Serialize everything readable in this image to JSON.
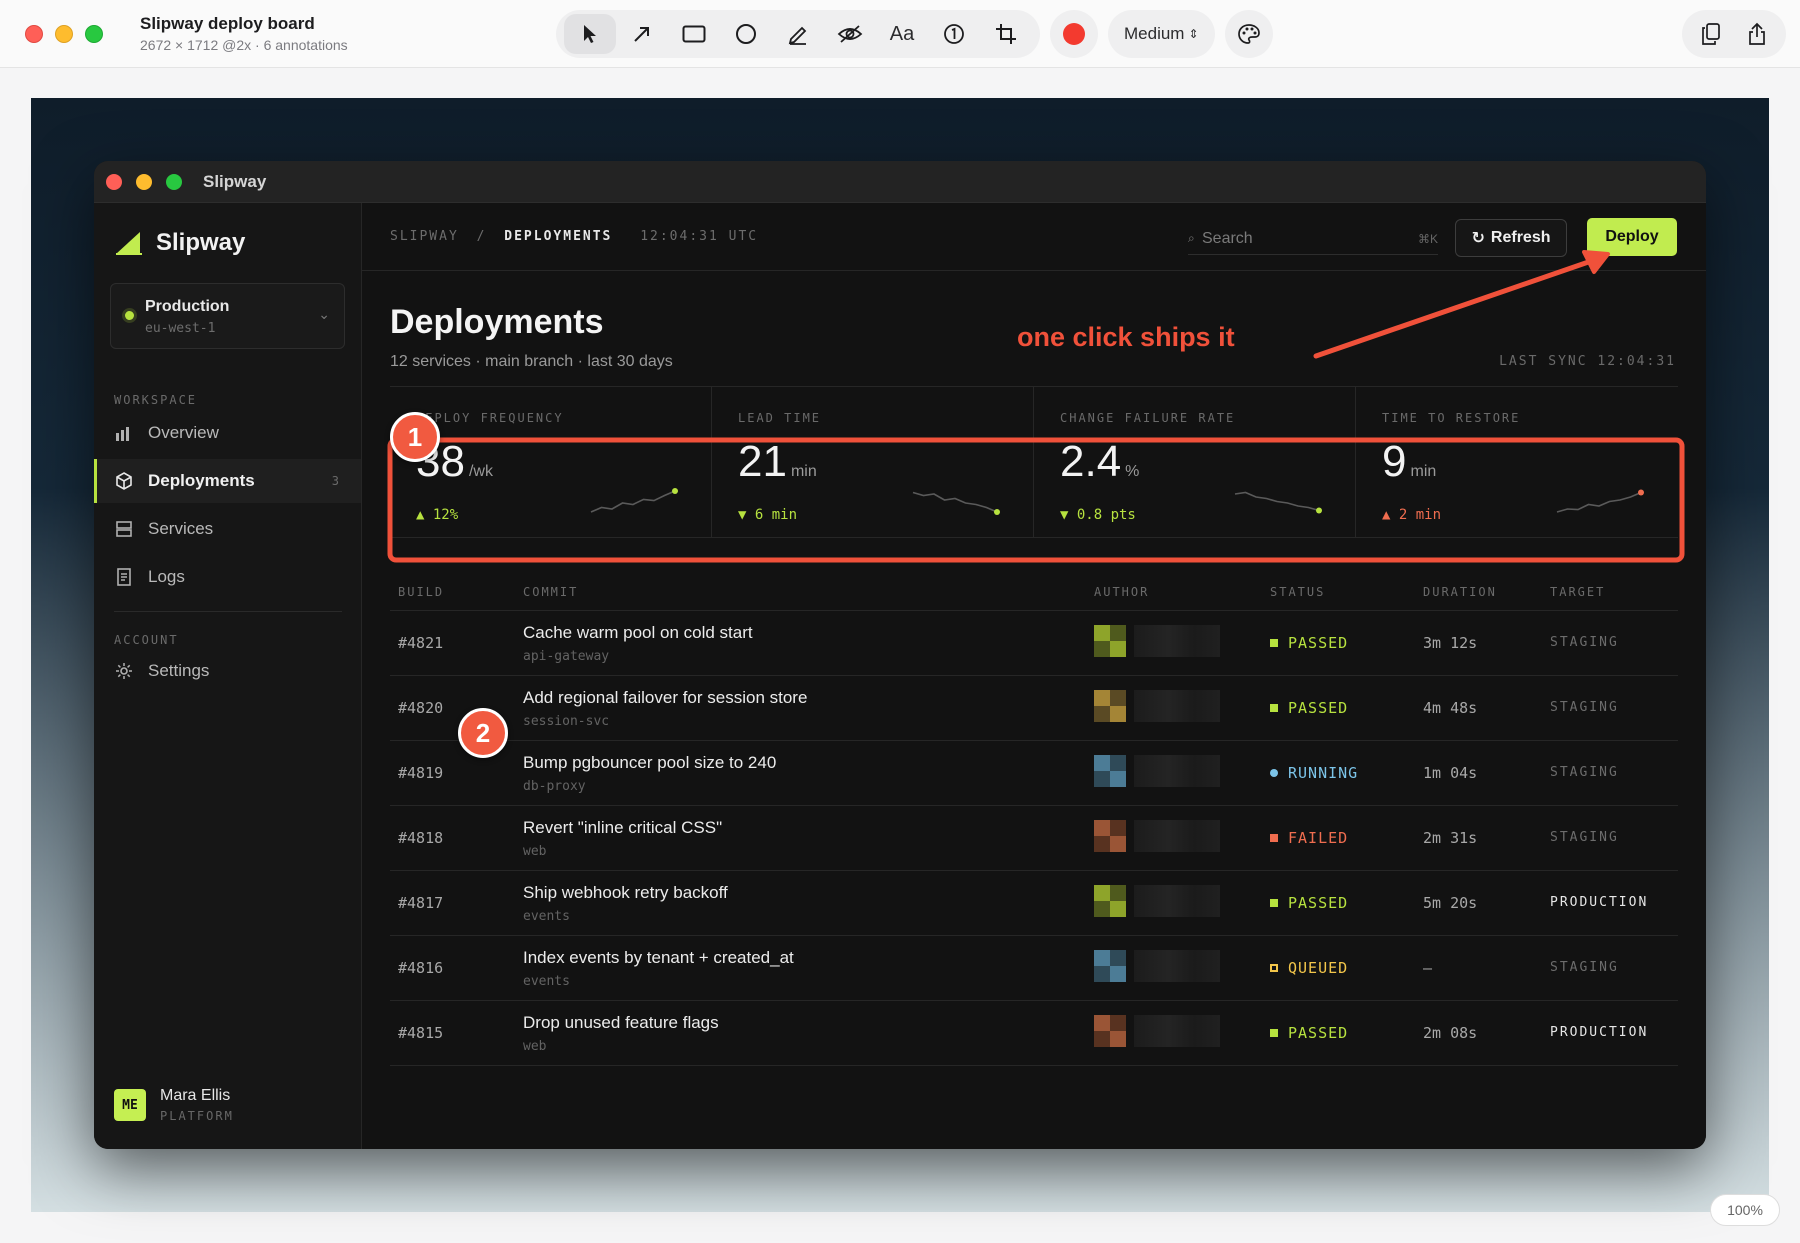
{
  "chrome": {
    "title": "Slipway deploy board",
    "subtitle": "2672 × 1712 @2x · 6 annotations",
    "tools": [
      "pointer-icon",
      "arrow-icon",
      "rectangle-icon",
      "ellipse-icon",
      "pen-icon",
      "redact-icon",
      "text-icon",
      "step-icon",
      "crop-icon"
    ],
    "text_tool_label": "Aa",
    "selected_tool": "pointer",
    "color": "#f33a2f",
    "size_label": "Medium",
    "zoom": "100%"
  },
  "window": {
    "title": "Slipway"
  },
  "sidebar": {
    "brand": "Slipway",
    "environment": {
      "name": "Production",
      "region": "eu-west-1"
    },
    "workspace_label": "WORKSPACE",
    "items": [
      {
        "label": "Overview",
        "icon": "bar-chart-icon"
      },
      {
        "label": "Deployments",
        "icon": "cube-icon",
        "badge": "3",
        "active": true
      },
      {
        "label": "Services",
        "icon": "server-icon"
      },
      {
        "label": "Logs",
        "icon": "document-icon"
      }
    ],
    "account_label": "ACCOUNT",
    "settings_label": "Settings",
    "user": {
      "initials": "ME",
      "name": "Mara Ellis",
      "team": "PLATFORM"
    }
  },
  "topbar": {
    "crumb_root": "SLIPWAY",
    "crumb_sep": "/",
    "crumb_current": "DEPLOYMENTS",
    "time": "12:04:31 UTC",
    "search_placeholder": "Search",
    "search_shortcut": "⌘K",
    "refresh_label": "Refresh",
    "deploy_label": "Deploy"
  },
  "page": {
    "title": "Deployments",
    "subtitle": "12 services · main branch · last 30 days",
    "last_sync": "LAST SYNC 12:04:31"
  },
  "metrics": [
    {
      "label": "DEPLOY FREQUENCY",
      "value": "38",
      "unit": "/wk",
      "delta": "▲ 12%",
      "trend": "good",
      "spark": [
        0.2,
        0.35,
        0.3,
        0.5,
        0.45,
        0.62,
        0.58,
        0.75,
        0.9
      ]
    },
    {
      "label": "LEAD TIME",
      "value": "21",
      "unit": "min",
      "delta": "▼ 6 min",
      "trend": "good",
      "spark": [
        0.85,
        0.75,
        0.8,
        0.6,
        0.65,
        0.5,
        0.45,
        0.35,
        0.2
      ]
    },
    {
      "label": "CHANGE FAILURE RATE",
      "value": "2.4",
      "unit": "%",
      "delta": "▼ 0.8 pts",
      "trend": "good",
      "spark": [
        0.8,
        0.85,
        0.7,
        0.65,
        0.55,
        0.5,
        0.4,
        0.35,
        0.25
      ]
    },
    {
      "label": "TIME TO RESTORE",
      "value": "9",
      "unit": "min",
      "delta": "▲ 2 min",
      "trend": "bad",
      "spark": [
        0.2,
        0.3,
        0.28,
        0.45,
        0.4,
        0.55,
        0.6,
        0.7,
        0.85
      ]
    }
  ],
  "table": {
    "headers": [
      "BUILD",
      "COMMIT",
      "AUTHOR",
      "STATUS",
      "DURATION",
      "TARGET"
    ],
    "rows": [
      {
        "build": "#4821",
        "message": "Cache warm pool on cold start",
        "service": "api-gateway",
        "status": "PASSED",
        "duration": "3m 12s",
        "target": "STAGING",
        "avatar": [
          "#8ea42a",
          "#4f5a1d"
        ]
      },
      {
        "build": "#4820",
        "message": "Add regional failover for session store",
        "service": "session-svc",
        "status": "PASSED",
        "duration": "4m 48s",
        "target": "STAGING",
        "avatar": [
          "#a48536",
          "#5a4a24"
        ]
      },
      {
        "build": "#4819",
        "message": "Bump pgbouncer pool size to 240",
        "service": "db-proxy",
        "status": "RUNNING",
        "duration": "1m 04s",
        "target": "STAGING",
        "avatar": [
          "#4c7c96",
          "#2f4a58"
        ]
      },
      {
        "build": "#4818",
        "message": "Revert \"inline critical CSS\"",
        "service": "web",
        "status": "FAILED",
        "duration": "2m 31s",
        "target": "STAGING",
        "avatar": [
          "#9a5536",
          "#583220"
        ]
      },
      {
        "build": "#4817",
        "message": "Ship webhook retry backoff",
        "service": "events",
        "status": "PASSED",
        "duration": "5m 20s",
        "target": "PRODUCTION",
        "avatar": [
          "#8ea42a",
          "#4f5a1d"
        ]
      },
      {
        "build": "#4816",
        "message": "Index events by tenant + created_at",
        "service": "events",
        "status": "QUEUED",
        "duration": "—",
        "target": "STAGING",
        "avatar": [
          "#4c7c96",
          "#2f4a58"
        ]
      },
      {
        "build": "#4815",
        "message": "Drop unused feature flags",
        "service": "web",
        "status": "PASSED",
        "duration": "2m 08s",
        "target": "PRODUCTION",
        "avatar": [
          "#9a5536",
          "#583220"
        ]
      }
    ]
  },
  "status_colors": {
    "PASSED": "#b7e23f",
    "RUNNING": "#7cc4e8",
    "FAILED": "#f06d4f",
    "QUEUED": "#f3c64a"
  },
  "annotations": {
    "callout": "one click ships it",
    "step1": "1",
    "step2": "2",
    "color": "#f0513a"
  }
}
